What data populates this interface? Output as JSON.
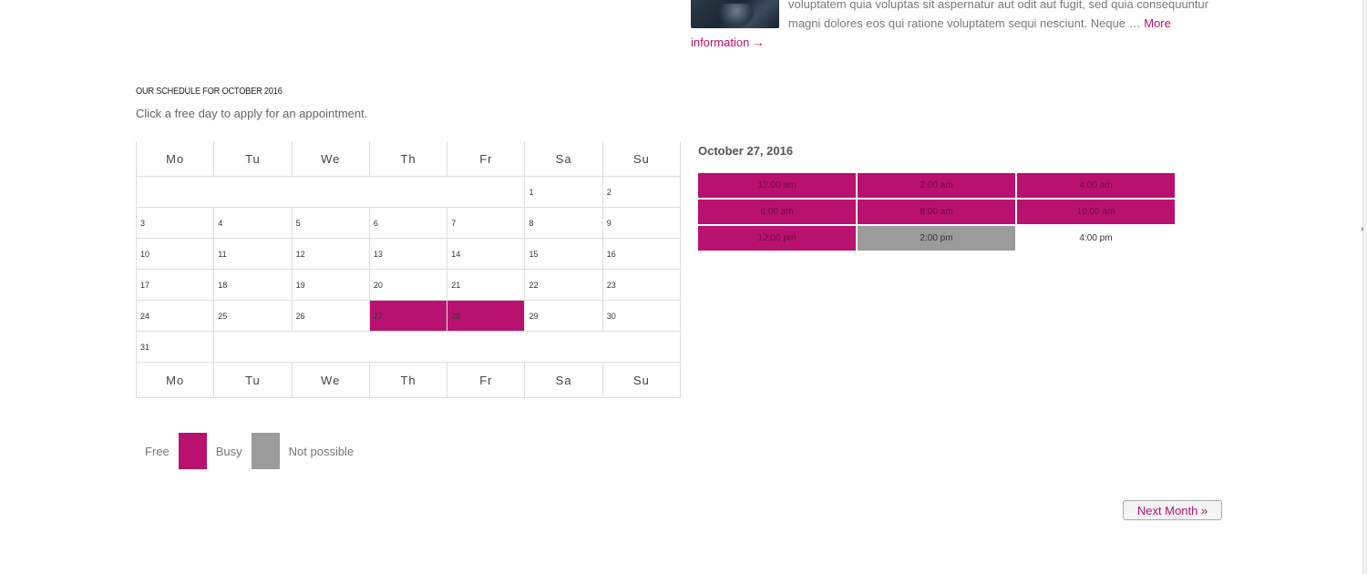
{
  "article": {
    "excerpt_line1": "voluptatem quia voluptas sit aspernatur aut odit aut fugit, sed quia consequuntur",
    "excerpt_line2": "magni dolores eos qui ratione voluptatem sequi nesciunt. Neque … ",
    "more_text": "More",
    "more_info_text": "information →"
  },
  "schedule": {
    "title": "OUR SCHEDULE FOR OCTOBER 2016",
    "hint": "Click a free day to apply for an appointment."
  },
  "calendar": {
    "weekdays": [
      "Mo",
      "Tu",
      "We",
      "Th",
      "Fr",
      "Sa",
      "Su"
    ],
    "weeks": [
      [
        "",
        "",
        "",
        "",
        "",
        "1",
        "2"
      ],
      [
        "3",
        "4",
        "5",
        "6",
        "7",
        "8",
        "9"
      ],
      [
        "10",
        "11",
        "12",
        "13",
        "14",
        "15",
        "16"
      ],
      [
        "17",
        "18",
        "19",
        "20",
        "21",
        "22",
        "23"
      ],
      [
        "24",
        "25",
        "26",
        "27",
        "28",
        "29",
        "30"
      ],
      [
        "31"
      ]
    ],
    "busy_days": [
      "27",
      "28"
    ],
    "past_days": [
      "26"
    ]
  },
  "slots_panel": {
    "date": "October 27, 2016",
    "slots": [
      {
        "time": "12:00 am",
        "status": "busy"
      },
      {
        "time": "2:00 am",
        "status": "busy"
      },
      {
        "time": "4:00 am",
        "status": "busy"
      },
      {
        "time": "6:00 am",
        "status": "busy"
      },
      {
        "time": "8:00 am",
        "status": "busy"
      },
      {
        "time": "10:00 am",
        "status": "busy"
      },
      {
        "time": "12:00 pm",
        "status": "busy"
      },
      {
        "time": "2:00 pm",
        "status": "not-possible"
      },
      {
        "time": "4:00 pm",
        "status": "free"
      }
    ]
  },
  "legend": {
    "free": "Free",
    "busy": "Busy",
    "not_possible": "Not possible"
  },
  "nav": {
    "next_month": "Next Month »"
  },
  "colors": {
    "accent": "#b9116f",
    "not_possible": "#9b9b9b"
  },
  "icons": {
    "scroll_arrow": "chevron-right-icon"
  }
}
